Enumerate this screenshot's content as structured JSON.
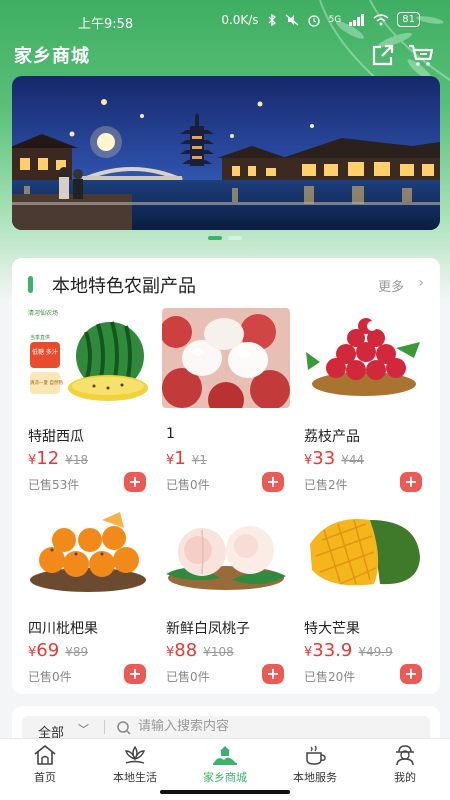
{
  "status": {
    "time": "上午9:58",
    "speed": "0.0K/s",
    "signal": "5G",
    "battery": "81"
  },
  "nav": {
    "title": "家乡商城",
    "share_icon": "share-icon",
    "cart_icon": "cart-icon"
  },
  "banner": {
    "slide_count": 2,
    "active_index": 0
  },
  "section": {
    "title": "本地特色农副产品",
    "more": "更多",
    "products": [
      {
        "name": "特甜西瓜",
        "yen": "¥",
        "price": "12",
        "original": "¥18",
        "sold": "已售53件",
        "brand": "清河仙农场",
        "tag1": "低糖 多汁",
        "tag2": "清凉一夏 自然熟",
        "tag0": "当季直供"
      },
      {
        "name": "1",
        "yen": "¥",
        "price": "1",
        "original": "¥1",
        "sold": "已售0件"
      },
      {
        "name": "荔枝产品",
        "yen": "¥",
        "price": "33",
        "original": "¥44",
        "sold": "已售2件"
      },
      {
        "name": "四川枇杷果",
        "yen": "¥",
        "price": "69",
        "original": "¥89",
        "sold": "已售0件"
      },
      {
        "name": "新鲜白凤桃子",
        "yen": "¥",
        "price": "88",
        "original": "¥108",
        "sold": "已售0件"
      },
      {
        "name": "特大芒果",
        "yen": "¥",
        "price": "33.9",
        "original": "¥49.9",
        "sold": "已售20件"
      }
    ]
  },
  "search": {
    "category": "全部",
    "placeholder": "请输入搜索内容"
  },
  "tabs": [
    {
      "label": "首页",
      "icon": "home-icon"
    },
    {
      "label": "本地生活",
      "icon": "lotus-icon"
    },
    {
      "label": "家乡商城",
      "icon": "mall-icon",
      "active": true
    },
    {
      "label": "本地服务",
      "icon": "coffee-icon"
    },
    {
      "label": "我的",
      "icon": "user-icon"
    }
  ],
  "colors": {
    "brand_green": "#3bb36a",
    "price_red": "#e53935",
    "add_button": "#ec5a55"
  }
}
